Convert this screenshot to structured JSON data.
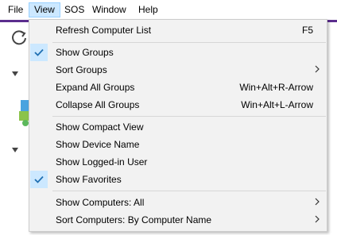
{
  "menubar": {
    "items": [
      {
        "label": "File"
      },
      {
        "label": "View"
      },
      {
        "label": "SOS"
      },
      {
        "label": "Window"
      },
      {
        "label": "Help"
      }
    ]
  },
  "colors": {
    "accent": "#5b2d8e",
    "menu_bg": "#f2f2f2",
    "active_bg": "#cce8ff",
    "check": "#1f6fb2"
  },
  "icons": {
    "refresh": "refresh-icon",
    "expand": "triangle-down-icon",
    "computer": "computer-icon"
  },
  "view_menu": {
    "refresh": {
      "label": "Refresh Computer List",
      "shortcut": "F5"
    },
    "show_groups": {
      "label": "Show Groups",
      "checked": true
    },
    "sort_groups": {
      "label": "Sort Groups"
    },
    "expand_all": {
      "label": "Expand All Groups",
      "shortcut": "Win+Alt+R-Arrow"
    },
    "collapse_all": {
      "label": "Collapse All Groups",
      "shortcut": "Win+Alt+L-Arrow"
    },
    "compact_view": {
      "label": "Show Compact View"
    },
    "device_name": {
      "label": "Show Device Name"
    },
    "logged_in_user": {
      "label": "Show Logged-in User"
    },
    "favorites": {
      "label": "Show Favorites",
      "checked": true
    },
    "show_computers": {
      "label": "Show Computers: All"
    },
    "sort_computers": {
      "label": "Sort Computers: By Computer Name"
    }
  }
}
